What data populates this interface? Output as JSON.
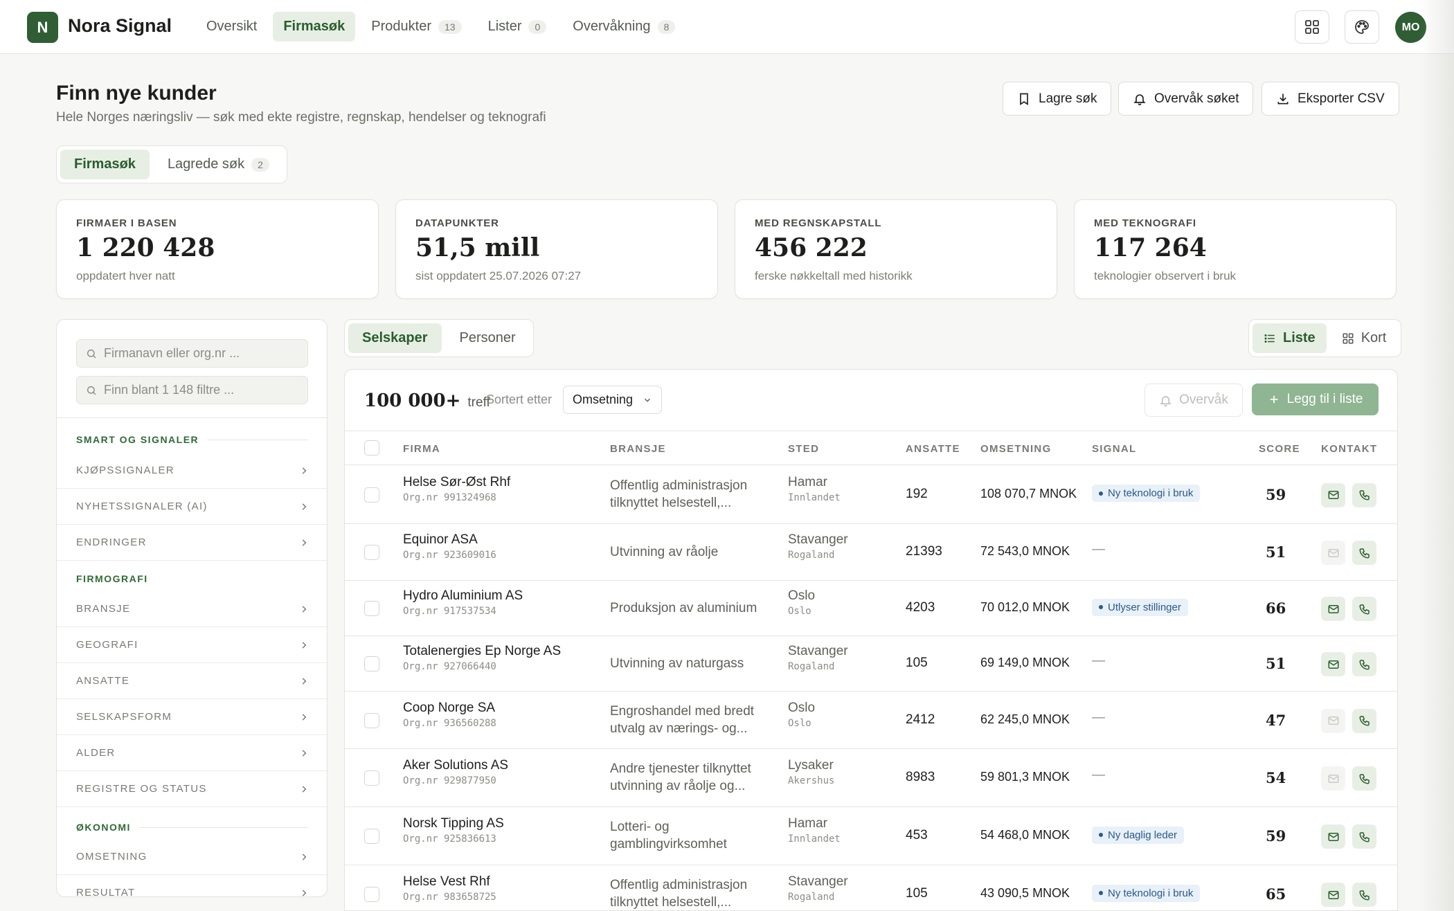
{
  "app": {
    "logo_letter": "N",
    "title": "Nora Signal",
    "avatar_initials": "MO"
  },
  "nav": [
    {
      "label": "Oversikt",
      "count": ""
    },
    {
      "label": "Firmasøk",
      "count": ""
    },
    {
      "label": "Produkter",
      "count": "13"
    },
    {
      "label": "Lister",
      "count": "0"
    },
    {
      "label": "Overvåkning",
      "count": "8"
    }
  ],
  "header": {
    "title": "Finn nye kunder",
    "subtitle": "Hele Norges næringsliv — søk med ekte registre, regnskap, hendelser og teknografi",
    "save_label": "Lagre søk",
    "watch_label": "Overvåk søket",
    "export_label": "Eksporter CSV"
  },
  "page_tabs": {
    "search": "Firmasøk",
    "saved": "Lagrede søk",
    "saved_count": "2"
  },
  "stats": [
    {
      "label": "FIRMAER I BASEN",
      "value": "1 220 428",
      "note": "oppdatert hver natt"
    },
    {
      "label": "DATAPUNKTER",
      "value": "51,5 mill",
      "note": "sist oppdatert 25.07.2026 07:27"
    },
    {
      "label": "MED REGNSKAPSTALL",
      "value": "456 222",
      "note": "ferske nøkkeltall med historikk"
    },
    {
      "label": "MED TEKNOGRAFI",
      "value": "117 264",
      "note": "teknologier observert i bruk"
    }
  ],
  "sidebar": {
    "name_placeholder": "Firmanavn eller org.nr ...",
    "filter_placeholder": "Finn blant 1 148 filtre ...",
    "sections": [
      {
        "title": "SMART OG SIGNALER",
        "items": [
          "KJØPSSIGNALER",
          "NYHETSSIGNALER (AI)",
          "ENDRINGER"
        ]
      },
      {
        "title": "FIRMOGRAFI",
        "items": [
          "BRANSJE",
          "GEOGRAFI",
          "ANSATTE",
          "SELSKAPSFORM",
          "ALDER",
          "REGISTRE OG STATUS"
        ]
      },
      {
        "title": "ØKONOMI",
        "items": [
          "OMSETNING",
          "RESULTAT"
        ]
      }
    ]
  },
  "result_tabs": {
    "companies": "Selskaper",
    "people": "Personer"
  },
  "view_toggle": {
    "list": "Liste",
    "cards": "Kort"
  },
  "results": {
    "hits": "100 000+",
    "hits_word": "treff",
    "sort_label": "Sortert etter",
    "sort_value": "Omsetning",
    "watch_label": "Overvåk",
    "add_label": "Legg til i liste",
    "columns": [
      "FIRMA",
      "BRANSJE",
      "STED",
      "ANSATTE",
      "OMSETNING",
      "SIGNAL",
      "SCORE",
      "KONTAKT"
    ],
    "rows": [
      {
        "name": "Helse Sør-Øst Rhf",
        "orgnr": "Org.nr 991324968",
        "bransje": "Offentlig administrasjon tilknyttet helsestell,...",
        "sted": "Hamar",
        "fylke": "Innlandet",
        "ansatte": "192",
        "omsetning": "108 070,7 MNOK",
        "signal": "Ny teknologi i bruk",
        "score": "59",
        "email": true
      },
      {
        "name": "Equinor ASA",
        "orgnr": "Org.nr 923609016",
        "bransje": "Utvinning av råolje",
        "sted": "Stavanger",
        "fylke": "Rogaland",
        "ansatte": "21393",
        "omsetning": "72 543,0 MNOK",
        "signal": "",
        "score": "51",
        "email": false
      },
      {
        "name": "Hydro Aluminium AS",
        "orgnr": "Org.nr 917537534",
        "bransje": "Produksjon av aluminium",
        "sted": "Oslo",
        "fylke": "Oslo",
        "ansatte": "4203",
        "omsetning": "70 012,0 MNOK",
        "signal": "Utlyser stillinger",
        "score": "66",
        "email": true
      },
      {
        "name": "Totalenergies Ep Norge AS",
        "orgnr": "Org.nr 927066440",
        "bransje": "Utvinning av naturgass",
        "sted": "Stavanger",
        "fylke": "Rogaland",
        "ansatte": "105",
        "omsetning": "69 149,0 MNOK",
        "signal": "",
        "score": "51",
        "email": true
      },
      {
        "name": "Coop Norge SA",
        "orgnr": "Org.nr 936560288",
        "bransje": "Engroshandel med bredt utvalg av nærings- og...",
        "sted": "Oslo",
        "fylke": "Oslo",
        "ansatte": "2412",
        "omsetning": "62 245,0 MNOK",
        "signal": "",
        "score": "47",
        "email": false
      },
      {
        "name": "Aker Solutions AS",
        "orgnr": "Org.nr 929877950",
        "bransje": "Andre tjenester tilknyttet utvinning av råolje og...",
        "sted": "Lysaker",
        "fylke": "Akershus",
        "ansatte": "8983",
        "omsetning": "59 801,3 MNOK",
        "signal": "",
        "score": "54",
        "email": false
      },
      {
        "name": "Norsk Tipping AS",
        "orgnr": "Org.nr 925836613",
        "bransje": "Lotteri- og gamblingvirksomhet",
        "sted": "Hamar",
        "fylke": "Innlandet",
        "ansatte": "453",
        "omsetning": "54 468,0 MNOK",
        "signal": "Ny daglig leder",
        "score": "59",
        "email": true
      },
      {
        "name": "Helse Vest Rhf",
        "orgnr": "Org.nr 983658725",
        "bransje": "Offentlig administrasjon tilknyttet helsestell,...",
        "sted": "Stavanger",
        "fylke": "Rogaland",
        "ansatte": "105",
        "omsetning": "43 090,5 MNOK",
        "signal": "Ny teknologi i bruk",
        "score": "65",
        "email": true
      }
    ],
    "empty_signal": "—"
  },
  "colors": {
    "brand": "#2f5d34",
    "accent_bg": "#e7efe4",
    "signal_bg": "#e8f0f8",
    "signal_text": "#2a5a8a"
  }
}
